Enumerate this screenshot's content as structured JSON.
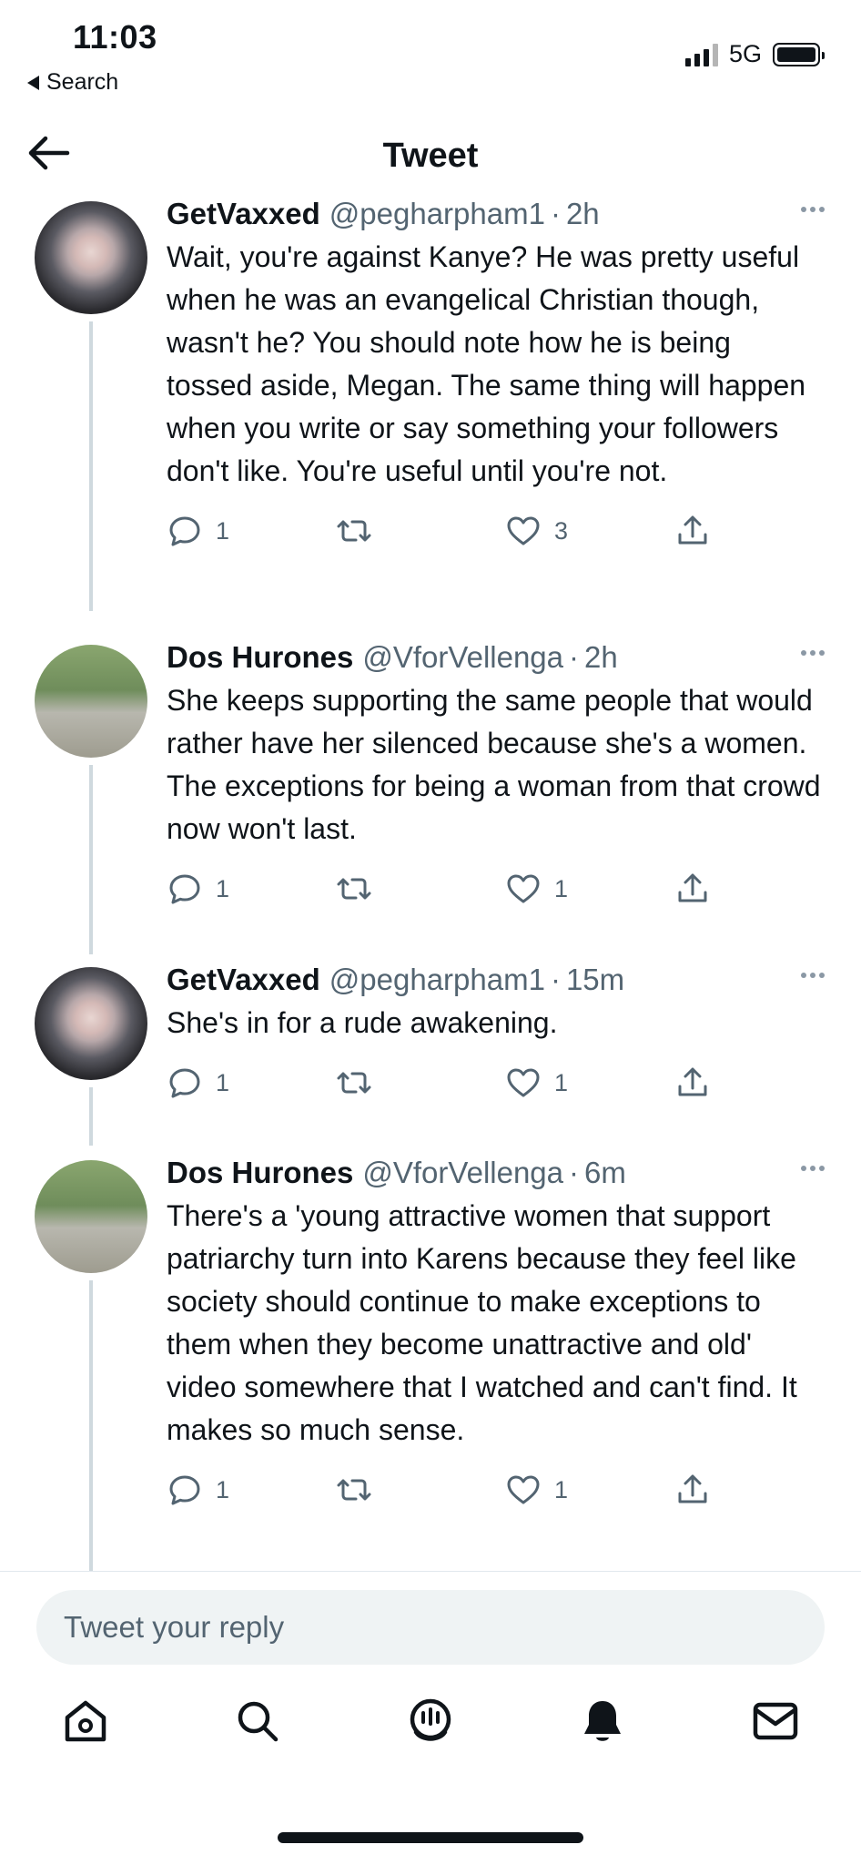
{
  "status_bar": {
    "time": "11:03",
    "back_label": "Search",
    "network": "5G"
  },
  "header": {
    "title": "Tweet"
  },
  "tweets": [
    {
      "name": "GetVaxxed",
      "handle": "@pegharpham1",
      "sep": "·",
      "time": "2h",
      "text": "Wait, you're against Kanye? He was pretty useful when he was an evangelical Christian though, wasn't he? You should note how he is being tossed aside, Megan. The same thing will happen when you write or say something your followers don't like. You're useful until you're not.",
      "replies": "1",
      "retweets": "",
      "likes": "3"
    },
    {
      "name": "Dos Hurones",
      "handle": "@VforVellenga",
      "sep": "·",
      "time": "2h",
      "text": "She keeps supporting the same people that would rather have her silenced because she's a women. The exceptions for being a woman from that crowd now won't last.",
      "replies": "1",
      "retweets": "",
      "likes": "1"
    },
    {
      "name": "GetVaxxed",
      "handle": "@pegharpham1",
      "sep": "·",
      "time": "15m",
      "text": "She's in for a rude awakening.",
      "replies": "1",
      "retweets": "",
      "likes": "1"
    },
    {
      "name": "Dos Hurones",
      "handle": "@VforVellenga",
      "sep": "·",
      "time": "6m",
      "text": "There's a 'young attractive women that support patriarchy turn into Karens because they feel like society should continue to make exceptions to them when they become unattractive and old' video somewhere that I watched and can't find. It makes so much sense.",
      "replies": "1",
      "retweets": "",
      "likes": "1"
    }
  ],
  "reply": {
    "placeholder": "Tweet your reply"
  },
  "colors": {
    "text": "#0f1419",
    "secondary": "#536471",
    "thread_line": "#cfd9de",
    "input_bg": "#eff3f4"
  },
  "icons": [
    "back-arrow-icon",
    "reply-icon",
    "retweet-icon",
    "like-icon",
    "share-icon",
    "home-icon",
    "search-icon",
    "spaces-icon",
    "notifications-icon",
    "messages-icon"
  ]
}
